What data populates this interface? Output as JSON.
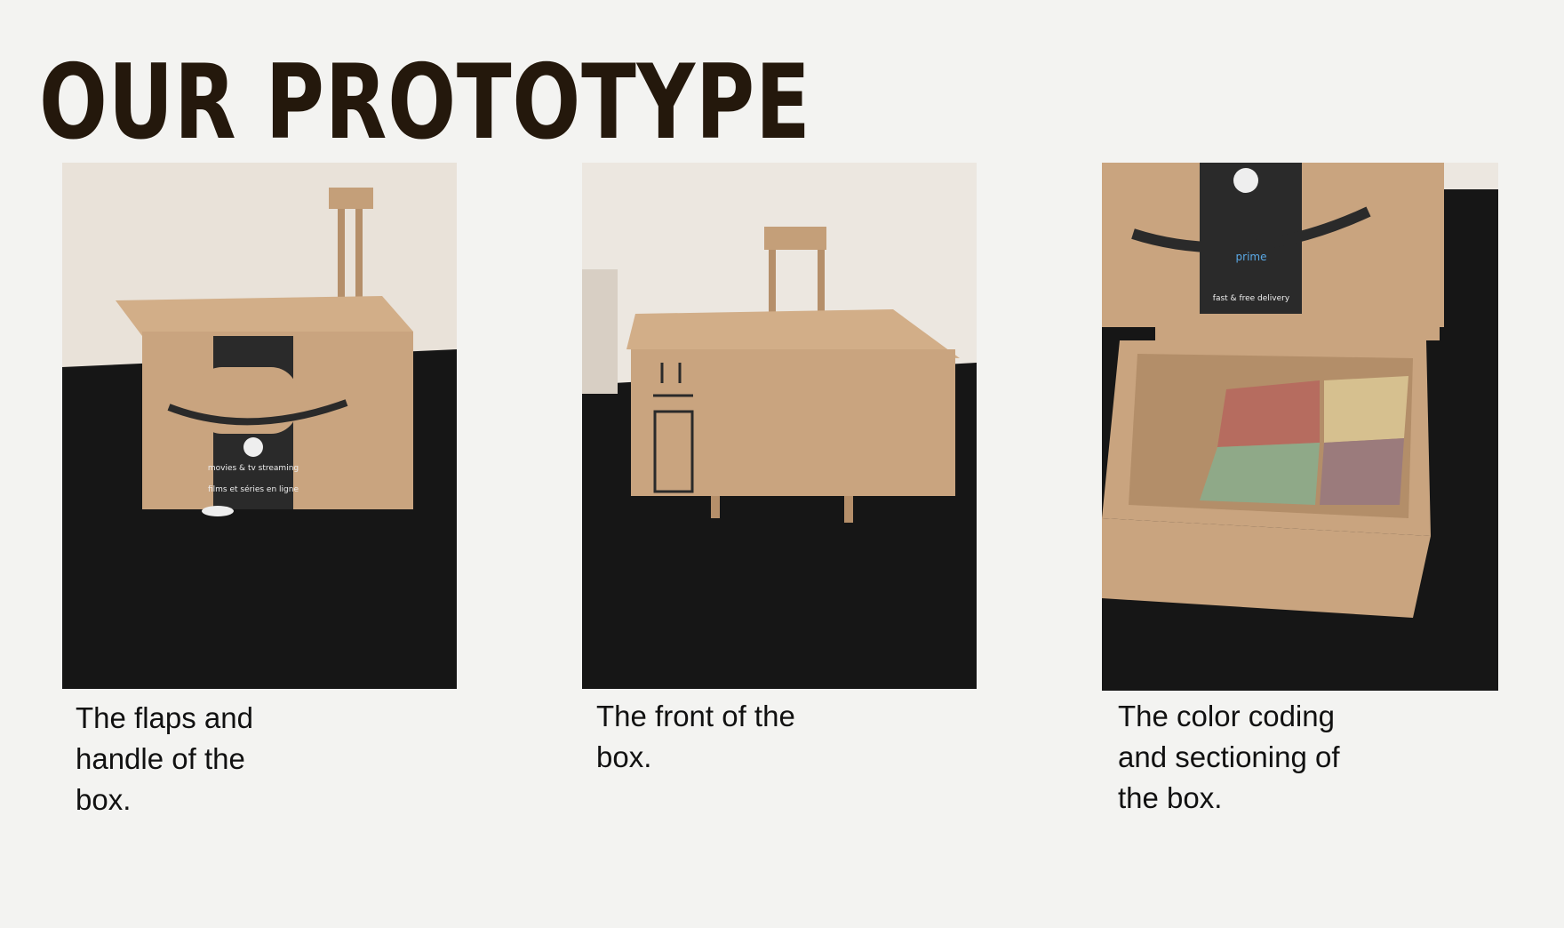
{
  "title": "OUR PROTOTYPE",
  "photos": [
    {
      "caption": "The flaps and handle of the box.",
      "box_print": {
        "top_text": "movies & tv streaming",
        "bottom_text": "films et séries en ligne"
      }
    },
    {
      "caption": "The front of the box."
    },
    {
      "caption": "The color coding and sectioning of the box.",
      "box_print": {
        "top_text": "fast & free delivery",
        "bottom_text": "prime"
      }
    }
  ],
  "colors": {
    "title": "#24180c",
    "background": "#f3f3f1",
    "cardboard": "#c9a47f",
    "cloth": "#141414",
    "wall": "#ebe6df"
  }
}
